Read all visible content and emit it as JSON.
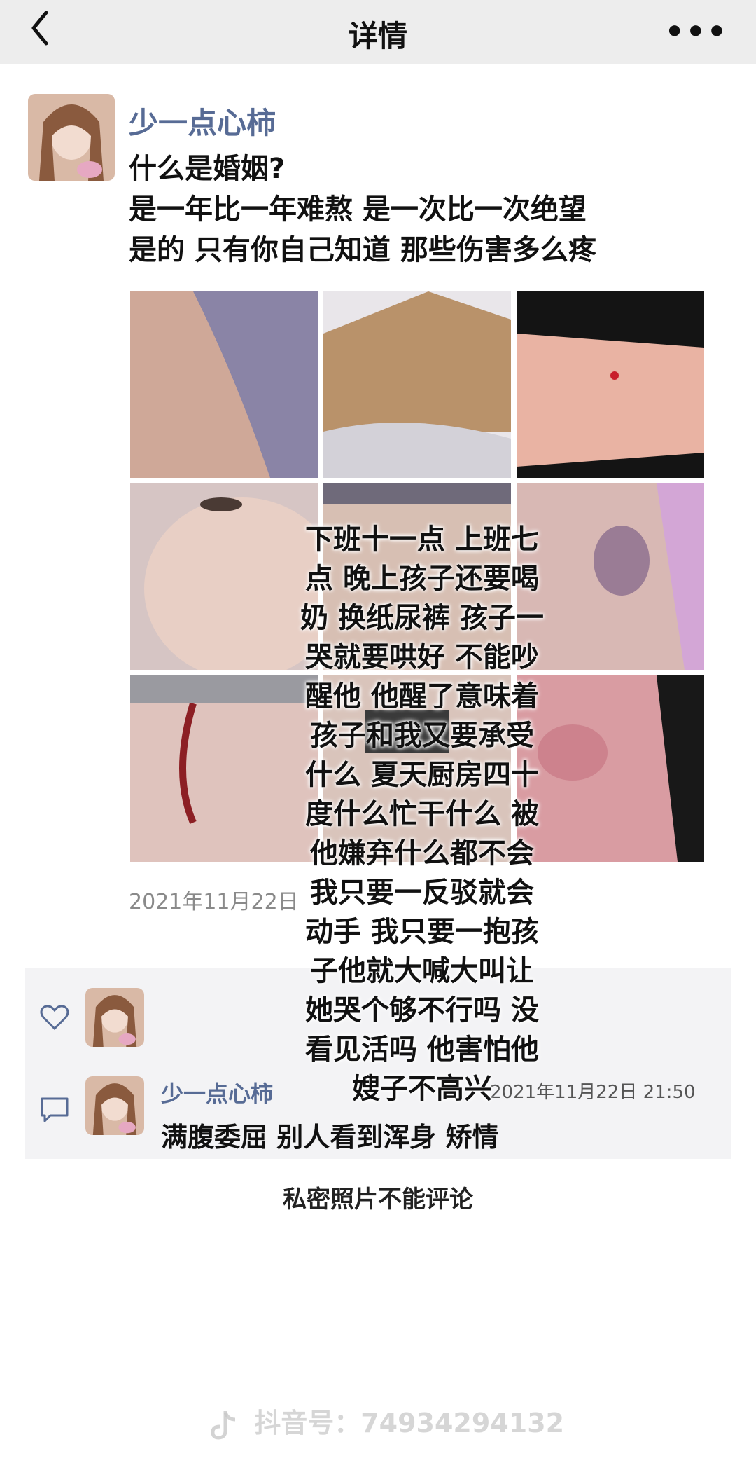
{
  "nav": {
    "title": "详情",
    "more": "•••"
  },
  "post": {
    "username": "少一点心柿",
    "text": "什么是婚姻?\n是一年比一年难熬 是一次比一次绝望\n是的 只有你自己知道 那些伤害多么疼",
    "time": "2021年11月22日",
    "photo_count": 9
  },
  "comment": {
    "username": "少一点心柿",
    "time": "2021年11月22日 21:50",
    "text": "满腹委屈 别人看到浑身 矫情"
  },
  "private_note": "私密照片不能评论",
  "overlay_text": "下班十一点 上班七\n点 晚上孩子还要喝\n奶 换纸尿裤 孩子一\n哭就要哄好 不能吵\n醒他 他醒了意味着\n孩子和我又要承受\n什么 夏天厨房四十\n度什么忙干什么 被\n他嫌弃什么都不会\n我只要一反驳就会\n动手 我只要一抱孩\n子他就大喊大叫让\n她哭个够不行吗 没\n看见活吗 他害怕他\n嫂子不高兴",
  "watermark": "抖音号：74934294132",
  "colors": {
    "username": "#576b95",
    "navbar_bg": "#ededed",
    "interact_bg": "#f3f3f5"
  }
}
